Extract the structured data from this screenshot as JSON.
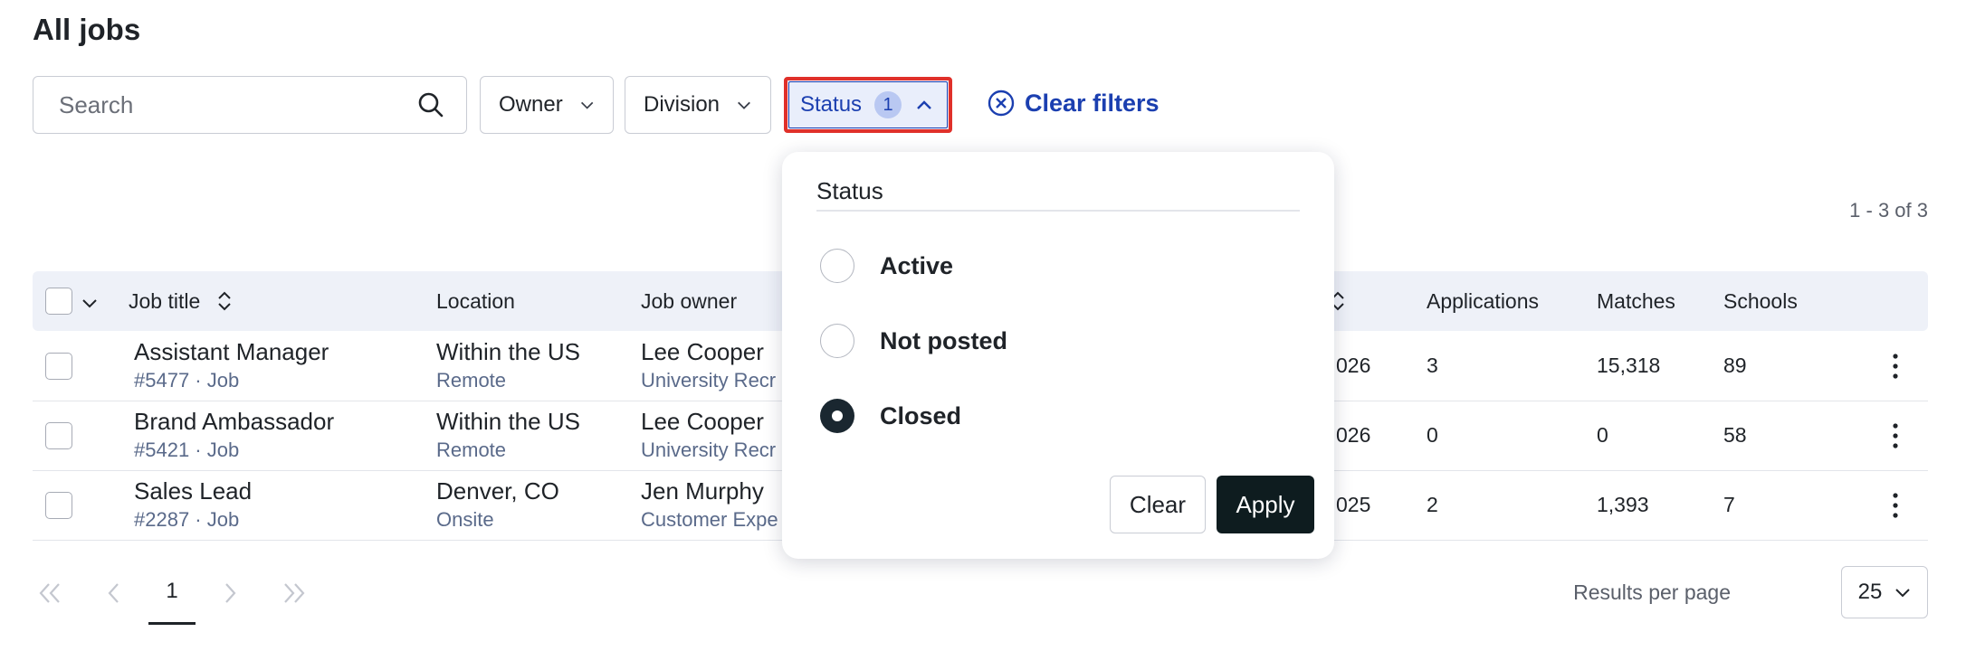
{
  "page": {
    "title": "All jobs"
  },
  "filters": {
    "search_placeholder": "Search",
    "owner_label": "Owner",
    "division_label": "Division",
    "status_label": "Status",
    "status_count": "1",
    "clear_filters_label": "Clear filters"
  },
  "results": {
    "count_text": "1 - 3 of 3"
  },
  "table": {
    "headers": {
      "job_title": "Job title",
      "location": "Location",
      "job_owner": "Job owner",
      "applications": "Applications",
      "matches": "Matches",
      "schools": "Schools"
    },
    "rows": [
      {
        "title": "Assistant Manager",
        "sub": "#5477 · Job",
        "location": "Within the US",
        "location_type": "Remote",
        "owner": "Lee Cooper",
        "owner_team": "University Recr",
        "date": "026",
        "applications": "3",
        "matches": "15,318",
        "schools": "89"
      },
      {
        "title": "Brand Ambassador",
        "sub": "#5421 · Job",
        "location": "Within the US",
        "location_type": "Remote",
        "owner": "Lee Cooper",
        "owner_team": "University Recr",
        "date": "026",
        "applications": "0",
        "matches": "0",
        "schools": "58"
      },
      {
        "title": "Sales Lead",
        "sub": "#2287 · Job",
        "location": "Denver, CO",
        "location_type": "Onsite",
        "owner": "Jen Murphy",
        "owner_team": "Customer Expe",
        "date": "025",
        "applications": "2",
        "matches": "1,393",
        "schools": "7"
      }
    ]
  },
  "pagination": {
    "current_page": "1",
    "results_per_page_label": "Results per page",
    "results_per_page_value": "25"
  },
  "status_popover": {
    "title": "Status",
    "options": [
      {
        "label": "Active",
        "checked": false
      },
      {
        "label": "Not posted",
        "checked": false
      },
      {
        "label": "Closed",
        "checked": true
      }
    ],
    "clear_label": "Clear",
    "apply_label": "Apply"
  },
  "colors": {
    "accent": "#1b3fb0",
    "highlight_border": "#e0302a",
    "apply_bg": "#0e1c1f",
    "table_header_bg": "#eef1f8"
  }
}
